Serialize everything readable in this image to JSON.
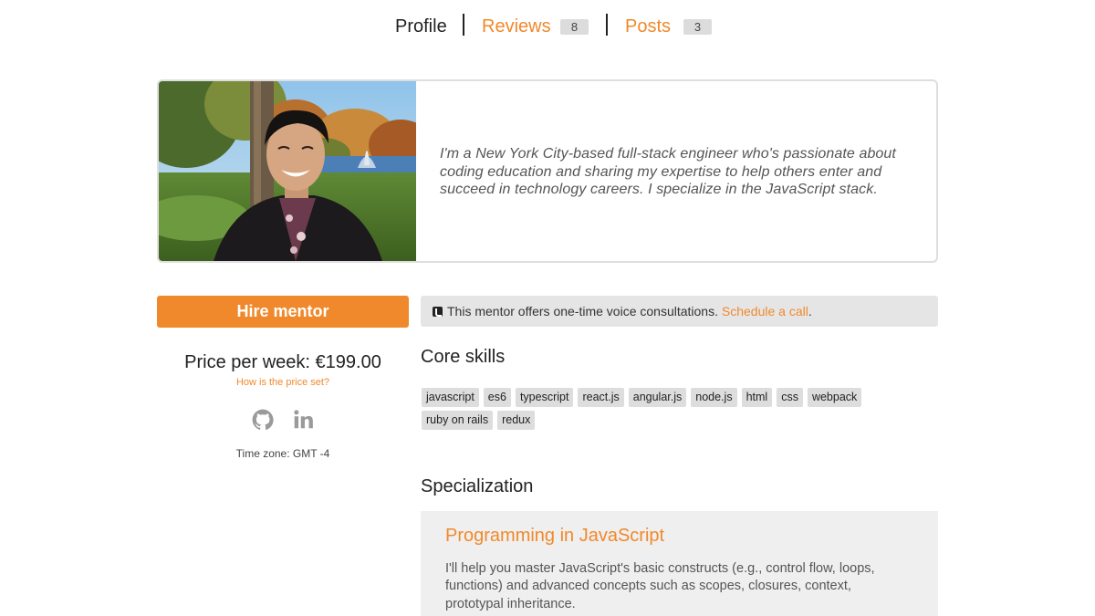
{
  "tabs": {
    "profile": "Profile",
    "reviews": "Reviews",
    "reviews_count": "8",
    "posts": "Posts",
    "posts_count": "3"
  },
  "intro": {
    "bio": "I'm a New York City-based full-stack engineer who's passionate about coding education and sharing my expertise to help others enter and succeed in technology careers. I specialize in the JavaScript stack."
  },
  "sidebar": {
    "hire_label": "Hire mentor",
    "price": "Price per week: €199.00",
    "price_link": "How is the price set?",
    "timezone": "Time zone: GMT -4",
    "social_icons": [
      "github-icon",
      "linkedin-icon"
    ]
  },
  "voice": {
    "text": "This mentor offers one-time voice consultations.",
    "link": "Schedule a call",
    "tail": "."
  },
  "core_skills": {
    "title": "Core skills",
    "items": [
      "javascript",
      "es6",
      "typescript",
      "react.js",
      "angular.js",
      "node.js",
      "html",
      "css",
      "webpack",
      "ruby on rails",
      "redux"
    ]
  },
  "specialization": {
    "title": "Specialization",
    "items": [
      {
        "name": "Programming in JavaScript",
        "description": "I'll help you master JavaScript's basic constructs (e.g., control flow, loops, functions) and advanced concepts such as scopes, closures, context, prototypal inheritance."
      }
    ]
  },
  "colors": {
    "accent": "#f0892b",
    "tag_bg": "#dedddd",
    "panel_bg": "#e6e5e6",
    "spec_bg": "#f0efef"
  }
}
